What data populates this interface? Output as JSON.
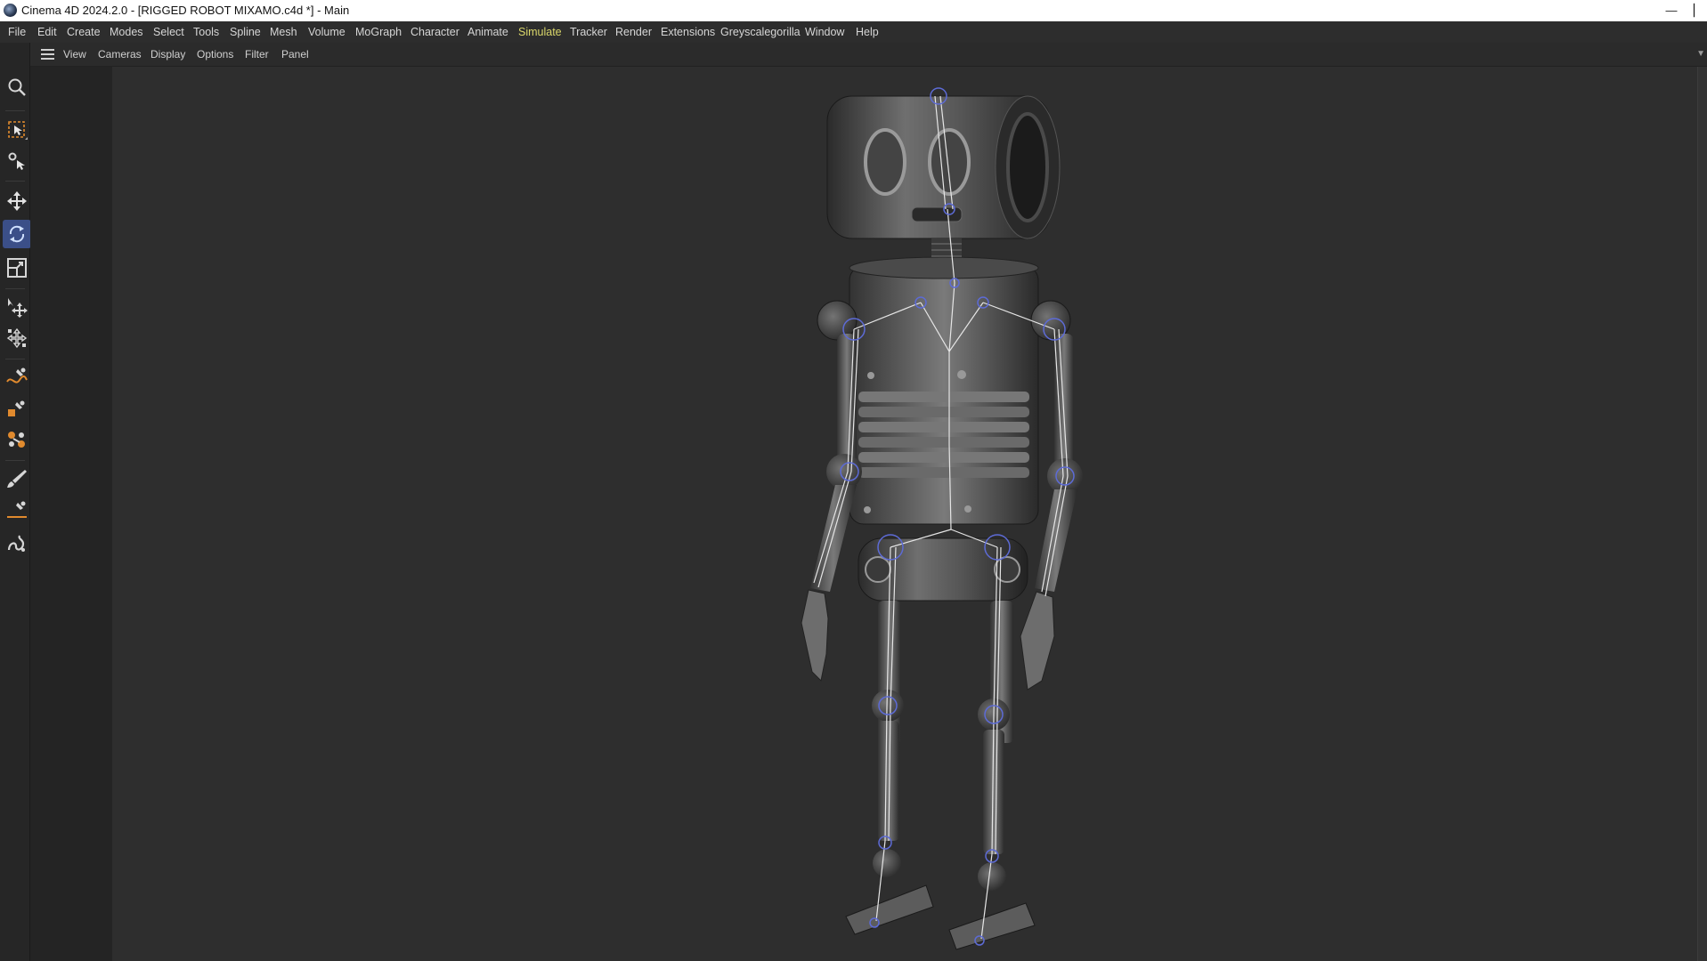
{
  "window": {
    "title": "Cinema 4D 2024.2.0 - [RIGGED ROBOT MIXAMO.c4d *] - Main",
    "minimize_glyph": "—",
    "edge_glyph": "▏"
  },
  "menu": {
    "items": [
      "File",
      "Edit",
      "Create",
      "Modes",
      "Select",
      "Tools",
      "Spline",
      "Mesh",
      "Volume",
      "MoGraph",
      "Character",
      "Animate",
      "Simulate",
      "Tracker",
      "Render",
      "Extensions",
      "Greyscalegorilla",
      "Window",
      "Help"
    ],
    "active": "Simulate"
  },
  "viewport_menu": {
    "items": [
      "View",
      "Cameras",
      "Display",
      "Options",
      "Filter",
      "Panel"
    ]
  },
  "toolbar": {
    "tools": [
      {
        "name": "search-icon",
        "active": false
      },
      {
        "name": "live-selection-icon",
        "active": false
      },
      {
        "name": "select-tool-icon",
        "active": false
      },
      {
        "name": "move-icon",
        "active": false
      },
      {
        "name": "rotate-icon",
        "active": true
      },
      {
        "name": "scale-icon",
        "active": false
      },
      {
        "name": "transfer-move-icon",
        "active": false
      },
      {
        "name": "transform-icon",
        "active": false
      },
      {
        "name": "spline-pen-icon",
        "active": false
      },
      {
        "name": "spline-sketch-icon",
        "active": false
      },
      {
        "name": "spline-mix-icon",
        "active": false
      },
      {
        "name": "paint-brush-icon",
        "active": false
      },
      {
        "name": "knife-line-icon",
        "active": false
      },
      {
        "name": "sketch-brush-icon",
        "active": false
      }
    ]
  },
  "colors": {
    "accent": "#3b4f88",
    "active_menu": "#d9d66a",
    "viewport_bg": "#2e2e2e",
    "joint_blue": "#5d6bd6",
    "bone_white": "#e6e6e6"
  },
  "scene": {
    "object": "rigged-robot",
    "display": "joints-and-bones-overlay"
  }
}
